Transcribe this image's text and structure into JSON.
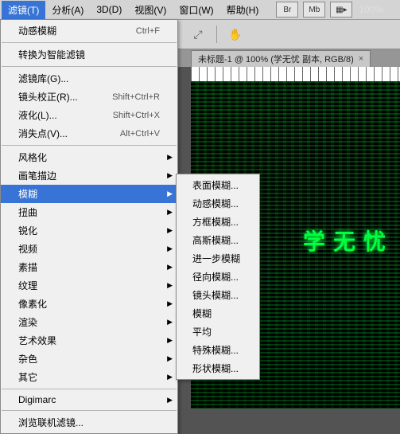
{
  "menubar": {
    "items": [
      {
        "label": "滤镜(T)",
        "open": true
      },
      {
        "label": "分析(A)"
      },
      {
        "label": "3D(D)"
      },
      {
        "label": "视图(V)"
      },
      {
        "label": "窗口(W)"
      },
      {
        "label": "帮助(H)"
      }
    ],
    "buttons": [
      {
        "name": "br-button",
        "label": "Br"
      },
      {
        "name": "mb-button",
        "label": "Mb"
      },
      {
        "name": "layout-button",
        "label": "▦▸"
      }
    ],
    "zoom": "100%"
  },
  "doc_tab": {
    "title": "未标题-1 @ 100% (学无忧 副本, RGB/8)",
    "close": "×"
  },
  "canvas_text": "学无忧",
  "filter_menu": {
    "groups": [
      [
        {
          "label": "动感模糊",
          "shortcut": "Ctrl+F"
        }
      ],
      [
        {
          "label": "转换为智能滤镜"
        }
      ],
      [
        {
          "label": "滤镜库(G)..."
        },
        {
          "label": "镜头校正(R)...",
          "shortcut": "Shift+Ctrl+R"
        },
        {
          "label": "液化(L)...",
          "shortcut": "Shift+Ctrl+X"
        },
        {
          "label": "消失点(V)...",
          "shortcut": "Alt+Ctrl+V"
        }
      ],
      [
        {
          "label": "风格化",
          "sub": true
        },
        {
          "label": "画笔描边",
          "sub": true
        },
        {
          "label": "模糊",
          "sub": true,
          "hl": true
        },
        {
          "label": "扭曲",
          "sub": true
        },
        {
          "label": "锐化",
          "sub": true
        },
        {
          "label": "视频",
          "sub": true
        },
        {
          "label": "素描",
          "sub": true
        },
        {
          "label": "纹理",
          "sub": true
        },
        {
          "label": "像素化",
          "sub": true
        },
        {
          "label": "渲染",
          "sub": true
        },
        {
          "label": "艺术效果",
          "sub": true
        },
        {
          "label": "杂色",
          "sub": true
        },
        {
          "label": "其它",
          "sub": true
        }
      ],
      [
        {
          "label": "Digimarc",
          "sub": true
        }
      ],
      [
        {
          "label": "浏览联机滤镜..."
        }
      ]
    ]
  },
  "blur_submenu": [
    "表面模糊...",
    "动感模糊...",
    "方框模糊...",
    "高斯模糊...",
    "进一步模糊",
    "径向模糊...",
    "镜头模糊...",
    "模糊",
    "平均",
    "特殊模糊...",
    "形状模糊..."
  ]
}
